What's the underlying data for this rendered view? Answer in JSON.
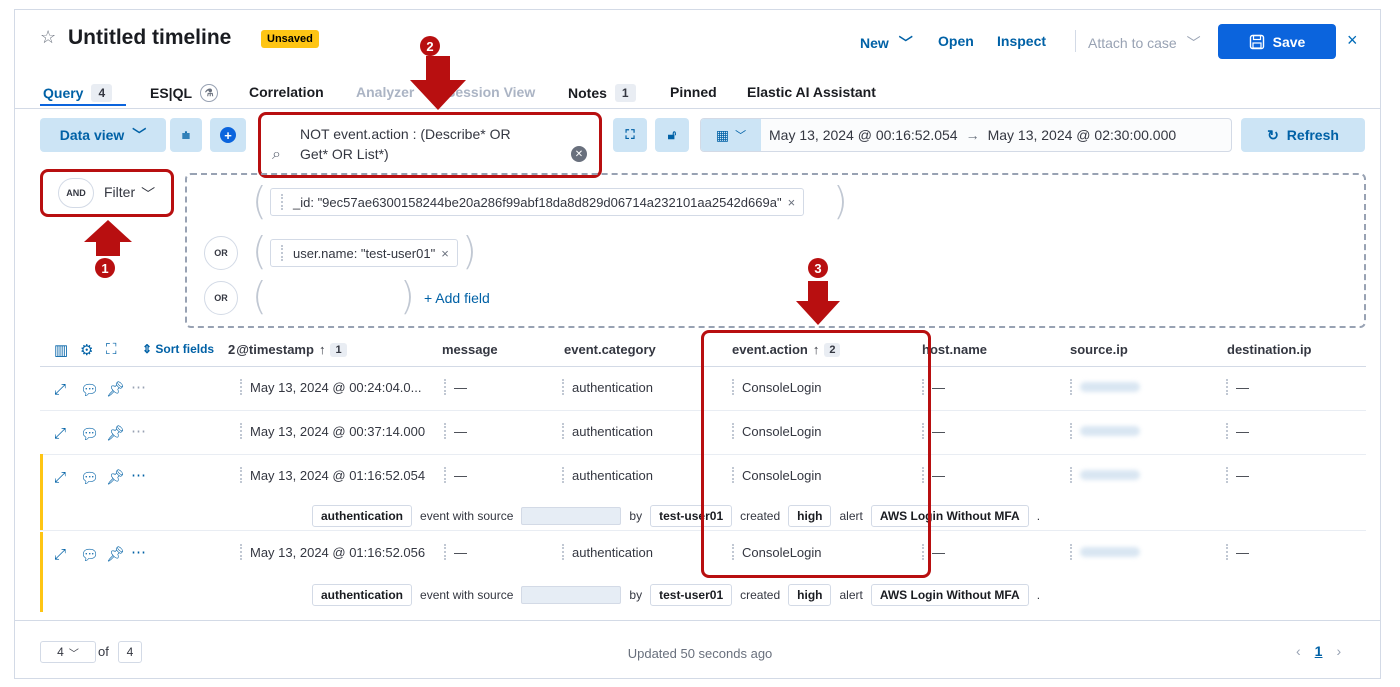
{
  "header": {
    "title": "Untitled timeline",
    "badge": "Unsaved",
    "new_label": "New",
    "open_label": "Open",
    "inspect_label": "Inspect",
    "attach_label": "Attach to case",
    "save_label": "Save",
    "close_label": "×"
  },
  "tabs": [
    {
      "label": "Query",
      "count": "4"
    },
    {
      "label": "ES|QL"
    },
    {
      "label": "Correlation"
    },
    {
      "label": "Analyzer"
    },
    {
      "label": "Session View"
    },
    {
      "label": "Notes",
      "count": "1"
    },
    {
      "label": "Pinned"
    },
    {
      "label": "Elastic AI Assistant"
    }
  ],
  "query_bar": {
    "data_view_label": "Data view",
    "query_line1": "NOT event.action : (Describe* OR",
    "query_line2": "Get* OR List*)",
    "date_start": "May 13, 2024 @ 00:16:52.054",
    "date_arrow": "→",
    "date_end": "May 13, 2024 @ 02:30:00.000",
    "refresh_label": "Refresh"
  },
  "filter": {
    "and_label": "AND",
    "filter_label": "Filter",
    "or_label": "OR",
    "chip1": "_id: \"9ec57ae6300158244be20a286f99abf18da8d829d06714a232101aa2542d669a\"",
    "chip2": "user.name: \"test-user01\"",
    "add_field": "+ Add field"
  },
  "table": {
    "sort_fields": "Sort fields",
    "sort_count": "2",
    "columns": {
      "timestamp": "@timestamp",
      "timestamp_sort": "1",
      "message": "message",
      "category": "event.category",
      "action": "event.action",
      "action_sort": "2",
      "host": "host.name",
      "source_ip": "source.ip",
      "destination_ip": "destination.ip"
    },
    "rows": [
      {
        "timestamp": "May 13, 2024 @ 00:24:04.0...",
        "message": "—",
        "category": "authentication",
        "action": "ConsoleLogin",
        "host": "—",
        "dest": "—"
      },
      {
        "timestamp": "May 13, 2024 @ 00:37:14.000",
        "message": "—",
        "category": "authentication",
        "action": "ConsoleLogin",
        "host": "—",
        "dest": "—"
      },
      {
        "timestamp": "May 13, 2024 @ 01:16:52.054",
        "message": "—",
        "category": "authentication",
        "action": "ConsoleLogin",
        "host": "—",
        "dest": "—"
      },
      {
        "timestamp": "May 13, 2024 @ 01:16:52.056",
        "message": "—",
        "category": "authentication",
        "action": "ConsoleLogin",
        "host": "—",
        "dest": "—"
      }
    ],
    "row_renderer": {
      "category": "authentication",
      "event_with_source": "event with source",
      "by": "by",
      "user": "test-user01",
      "created": "created",
      "severity": "high",
      "alert": "alert",
      "rule": "AWS Login Without MFA",
      "period": "."
    }
  },
  "footer": {
    "rows_per_page": "4",
    "of_label": "of",
    "total_pages": "4",
    "updated": "Updated 50 seconds ago",
    "current_page": "1"
  },
  "annotations": {
    "n1": "1",
    "n2": "2",
    "n3": "3",
    "color": "#b80f10"
  },
  "colors": {
    "accent": "#0b64dd",
    "link": "#0061a6",
    "unsaved_badge": "#fec514",
    "annotation": "#b80f10"
  }
}
